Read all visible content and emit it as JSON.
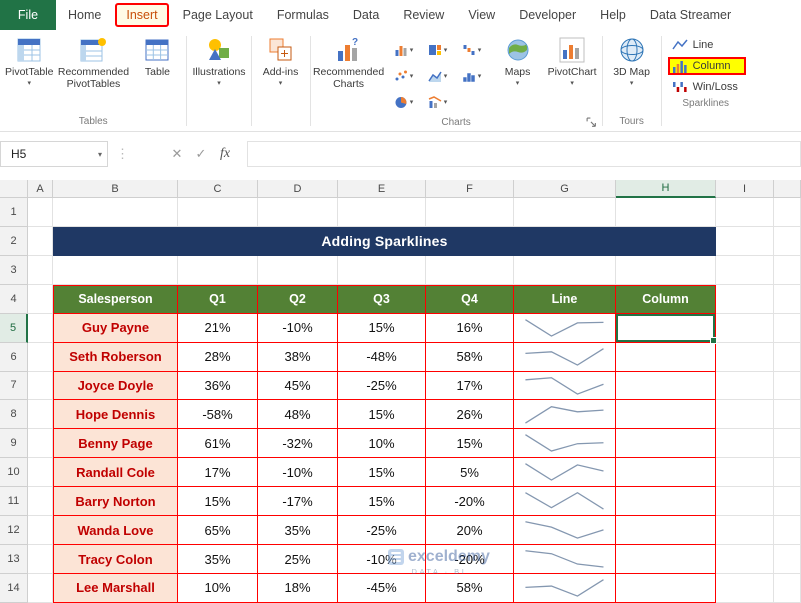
{
  "ribbon": {
    "file_tab": "File",
    "tabs": [
      {
        "label": "Home"
      },
      {
        "label": "Insert",
        "active": true,
        "highlighted": true
      },
      {
        "label": "Page Layout"
      },
      {
        "label": "Formulas"
      },
      {
        "label": "Data"
      },
      {
        "label": "Review"
      },
      {
        "label": "View"
      },
      {
        "label": "Developer"
      },
      {
        "label": "Help"
      },
      {
        "label": "Data Streamer"
      }
    ],
    "groups": {
      "tables": {
        "label": "Tables",
        "pivottable": "PivotTable",
        "recommended_pivottables": "Recommended PivotTables",
        "table": "Table"
      },
      "illustrations": {
        "label": "Illustrations"
      },
      "addins": {
        "label": "Add-ins"
      },
      "charts": {
        "label": "Charts",
        "recommended_charts": "Recommended Charts",
        "maps": "Maps",
        "pivotchart": "PivotChart"
      },
      "tours": {
        "label": "Tours",
        "map_3d": "3D Map"
      },
      "sparklines": {
        "label": "Sparklines",
        "line": "Line",
        "column": "Column",
        "win_loss": "Win/Loss"
      }
    }
  },
  "formula_bar": {
    "name_box": "H5",
    "fx_label": "fx",
    "formula": ""
  },
  "icons": {
    "dropdown_arrow": "▾",
    "cancel": "✕",
    "enter": "✓",
    "separator": "⋮"
  },
  "grid": {
    "column_headers": [
      "A",
      "B",
      "C",
      "D",
      "E",
      "F",
      "G",
      "H",
      "I"
    ],
    "selected_column": "H",
    "row_count": 14,
    "selected_row": 5,
    "selected_cell": "H5"
  },
  "sheet": {
    "title_banner": "Adding Sparklines",
    "table_headers": [
      "Salesperson",
      "Q1",
      "Q2",
      "Q3",
      "Q4",
      "Line",
      "Column"
    ],
    "salespeople": [
      {
        "name": "Guy Payne",
        "quarters": [
          "21%",
          "-10%",
          "15%",
          "16%"
        ]
      },
      {
        "name": "Seth Roberson",
        "quarters": [
          "28%",
          "38%",
          "-48%",
          "58%"
        ]
      },
      {
        "name": "Joyce Doyle",
        "quarters": [
          "36%",
          "45%",
          "-25%",
          "17%"
        ]
      },
      {
        "name": "Hope Dennis",
        "quarters": [
          "-58%",
          "48%",
          "15%",
          "26%"
        ]
      },
      {
        "name": "Benny Page",
        "quarters": [
          "61%",
          "-32%",
          "10%",
          "15%"
        ]
      },
      {
        "name": "Randall Cole",
        "quarters": [
          "17%",
          "-10%",
          "15%",
          "5%"
        ]
      },
      {
        "name": "Barry Norton",
        "quarters": [
          "15%",
          "-17%",
          "15%",
          "-20%"
        ]
      },
      {
        "name": "Wanda Love",
        "quarters": [
          "65%",
          "35%",
          "-25%",
          "20%"
        ]
      },
      {
        "name": "Tracy Colon",
        "quarters": [
          "35%",
          "25%",
          "-10%",
          "-20%"
        ]
      },
      {
        "name": "Lee Marshall",
        "quarters": [
          "10%",
          "18%",
          "-45%",
          "58%"
        ]
      }
    ]
  },
  "watermark": {
    "brand": "exceldemy",
    "tagline": "DATA · BI"
  },
  "colors": {
    "excel_green": "#217346",
    "banner_navy": "#1F3864",
    "header_green": "#538135",
    "name_fill": "#FCE4D6",
    "name_text": "#C00000",
    "table_border": "#FF0000",
    "annotation_red": "#FF0000",
    "annotation_yellow": "#FFFF00",
    "sparkline_blue": "#8497B0",
    "accent_blue": "#4472C4",
    "accent_orange": "#ED7D31"
  }
}
